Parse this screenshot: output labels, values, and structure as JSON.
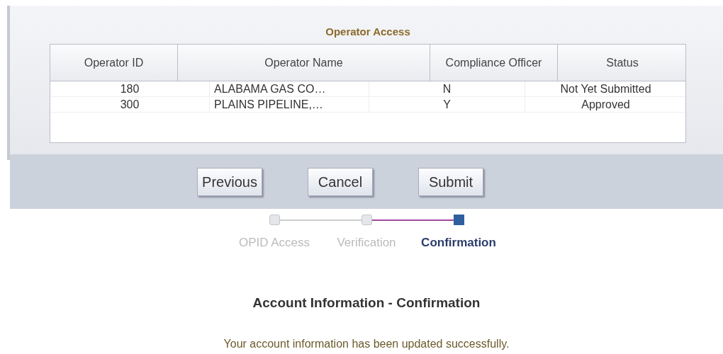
{
  "panel_title": "Operator Access",
  "table": {
    "columns": [
      "Operator ID",
      "Operator Name",
      "Compliance Officer",
      "Status"
    ],
    "rows": [
      {
        "cells": [
          "180",
          "ALABAMA GAS CO…",
          "N",
          "Not Yet Submitted"
        ]
      },
      {
        "cells": [
          "300",
          "PLAINS PIPELINE,…",
          "Y",
          "Approved"
        ]
      }
    ]
  },
  "buttons": [
    "Previous",
    "Cancel",
    "Submit"
  ],
  "steps": [
    {
      "label": "OPID Access",
      "selected": false
    },
    {
      "label": "Verification",
      "selected": false
    },
    {
      "label": "Confirmation",
      "selected": true
    }
  ],
  "heading": "Account Information - Confirmation",
  "message": "Your account information has been updated successfully."
}
